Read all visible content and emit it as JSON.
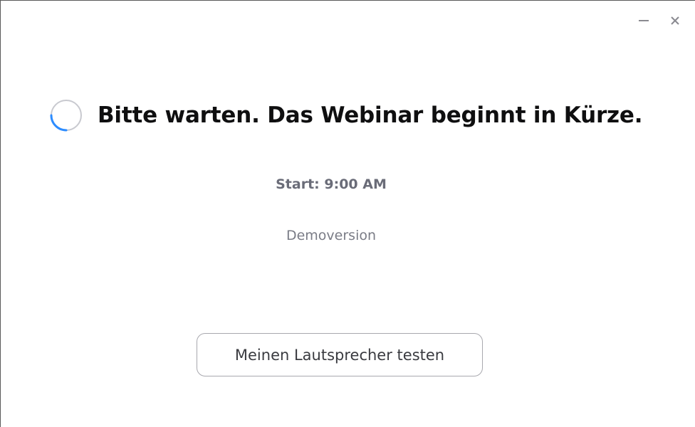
{
  "window": {
    "controls": {
      "minimize_icon": "minimize-icon",
      "close_icon": "close-icon"
    }
  },
  "main": {
    "heading": "Bitte warten. Das Webinar beginnt in Kürze.",
    "start_time": "Start: 9:00 AM",
    "version": "Demoversion",
    "test_speaker_button": "Meinen Lautsprecher testen"
  },
  "colors": {
    "spinner_track": "#c8c9cf",
    "spinner_accent": "#2d8cff",
    "heading_text": "#0f0f10",
    "muted_text": "#6a6c78"
  }
}
